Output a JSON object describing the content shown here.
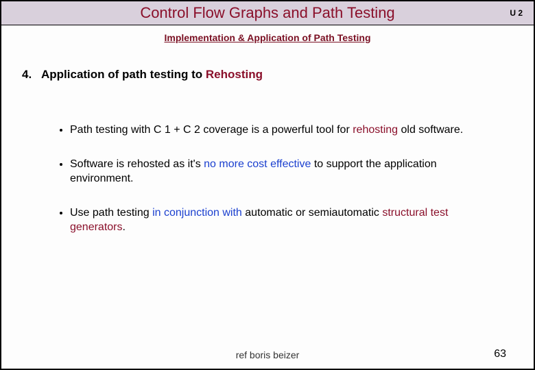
{
  "header": {
    "title": "Control Flow Graphs and Path Testing",
    "unit": "U 2"
  },
  "subtitle": "Implementation & Application of Path Testing",
  "heading": {
    "number": "4.",
    "prefix": "Application of path testing to ",
    "emph": "Rehosting"
  },
  "bullets": {
    "b1": {
      "pre": "Path testing with C 1 + C 2 coverage is a powerful tool for ",
      "em": "rehosting",
      "post": " old software."
    },
    "b2": {
      "pre": "Software is rehosted as it's ",
      "em": "no more cost effective",
      "post": " to support the application environment."
    },
    "b3": {
      "pre": "Use path testing ",
      "em1": "in conjunction with",
      "mid": " automatic or semiautomatic ",
      "em2": "structural test generators",
      "post": "."
    }
  },
  "footer": {
    "ref": "ref boris beizer",
    "page": "63"
  }
}
